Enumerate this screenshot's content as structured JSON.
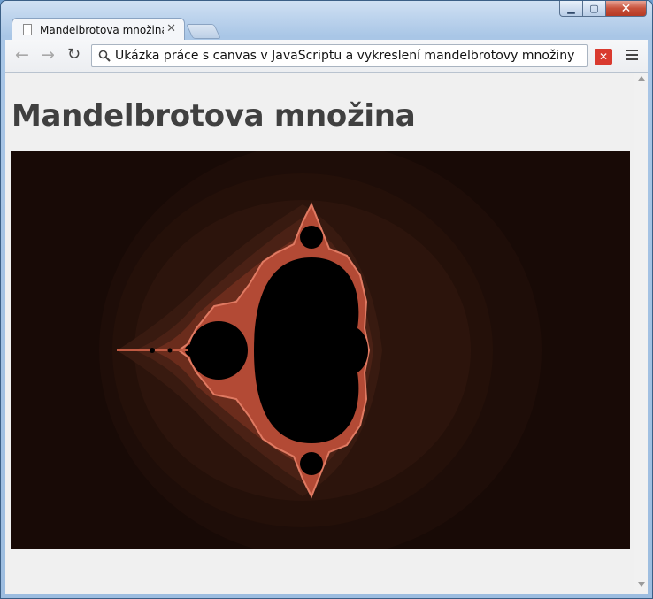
{
  "tab": {
    "title": "Mandelbrotova množina",
    "close_glyph": "✕",
    "icon": "document-icon"
  },
  "window": {
    "minimize_glyph": "▁",
    "maximize_glyph": "▢",
    "close_glyph": "✕"
  },
  "toolbar": {
    "back_glyph": "←",
    "forward_glyph": "→",
    "reload_glyph": "↻",
    "address": "Ukázka práce s canvas v JavaScriptu a vykreslení mandelbrotovy množiny",
    "extension_glyph": "✕"
  },
  "page": {
    "heading": "Mandelbrotova množina"
  },
  "colors": {
    "fractal_background": "#180a06",
    "fractal_set": "#000000",
    "fractal_edge": "#d96a55"
  }
}
